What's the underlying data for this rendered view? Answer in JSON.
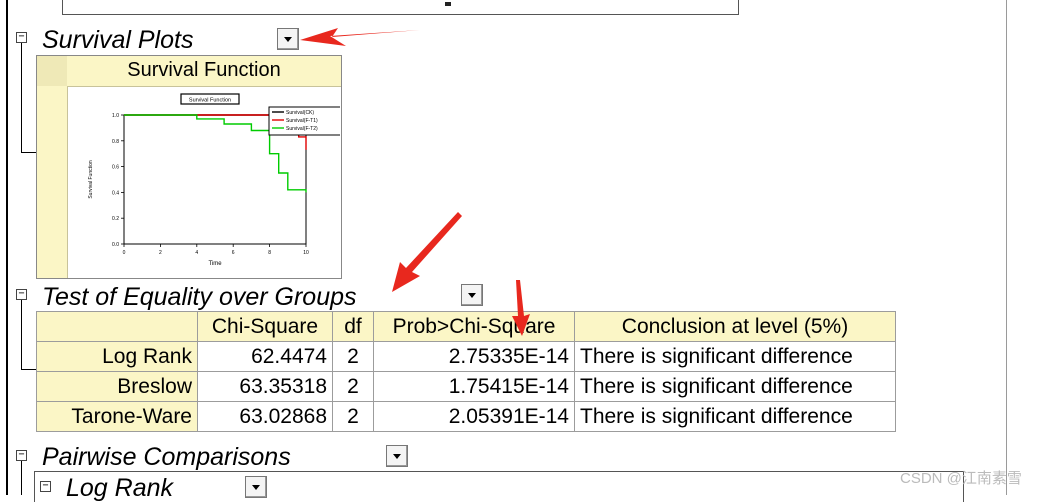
{
  "sections": {
    "survival_plots": {
      "title": "Survival Plots",
      "collapse_glyph": "−"
    },
    "test_equality": {
      "title": "Test of Equality over Groups",
      "collapse_glyph": "−"
    },
    "pairwise": {
      "title": "Pairwise Comparisons",
      "collapse_glyph": "−"
    },
    "log_rank_sub": {
      "title": "Log Rank",
      "collapse_glyph": "−"
    }
  },
  "plot_panel": {
    "header": "Survival Function"
  },
  "chart_data": {
    "type": "line",
    "title": "Survival Function",
    "xlabel": "Time",
    "ylabel": "Survival Function",
    "xlim": [
      0,
      10
    ],
    "ylim": [
      0,
      1.0
    ],
    "x_ticks": [
      "0",
      "2",
      "4",
      "6",
      "8",
      "10"
    ],
    "y_ticks": [
      "0.0",
      "0.2",
      "0.4",
      "0.6",
      "0.8",
      "1.0"
    ],
    "legend_position": "top-right",
    "series": [
      {
        "name": "Survival(CK)",
        "color": "#000000",
        "steps": [
          [
            0,
            1.0
          ],
          [
            10,
            1.0
          ]
        ]
      },
      {
        "name": "Survival(F-T1)",
        "color": "#e00000",
        "steps": [
          [
            0,
            1.0
          ],
          [
            8.2,
            1.0
          ],
          [
            8.2,
            0.93
          ],
          [
            9.6,
            0.93
          ],
          [
            9.6,
            0.83
          ],
          [
            10,
            0.83
          ],
          [
            10,
            0.73
          ]
        ]
      },
      {
        "name": "Survival(F-T2)",
        "color": "#00cc00",
        "steps": [
          [
            0,
            1.0
          ],
          [
            4,
            1.0
          ],
          [
            4,
            0.97
          ],
          [
            5.5,
            0.97
          ],
          [
            5.5,
            0.93
          ],
          [
            7,
            0.93
          ],
          [
            7,
            0.88
          ],
          [
            8,
            0.88
          ],
          [
            8,
            0.7
          ],
          [
            8.5,
            0.7
          ],
          [
            8.5,
            0.55
          ],
          [
            9,
            0.55
          ],
          [
            9,
            0.42
          ],
          [
            10,
            0.42
          ],
          [
            10,
            0.4
          ]
        ]
      }
    ]
  },
  "table": {
    "headers": [
      "",
      "Chi-Square",
      "df",
      "Prob>Chi-Square",
      "Conclusion at level (5%)"
    ],
    "rows": [
      {
        "label": "Log Rank",
        "chi": "62.4474",
        "df": "2",
        "prob": "2.75335E-14",
        "conclusion": "There is significant difference"
      },
      {
        "label": "Breslow",
        "chi": "63.35318",
        "df": "2",
        "prob": "1.75415E-14",
        "conclusion": "There is significant difference"
      },
      {
        "label": "Tarone-Ware",
        "chi": "63.02868",
        "df": "2",
        "prob": "2.05391E-14",
        "conclusion": "There is significant difference"
      }
    ]
  },
  "annotation_arrow_color": "#e8281e",
  "watermark": "CSDN @江南素雪"
}
